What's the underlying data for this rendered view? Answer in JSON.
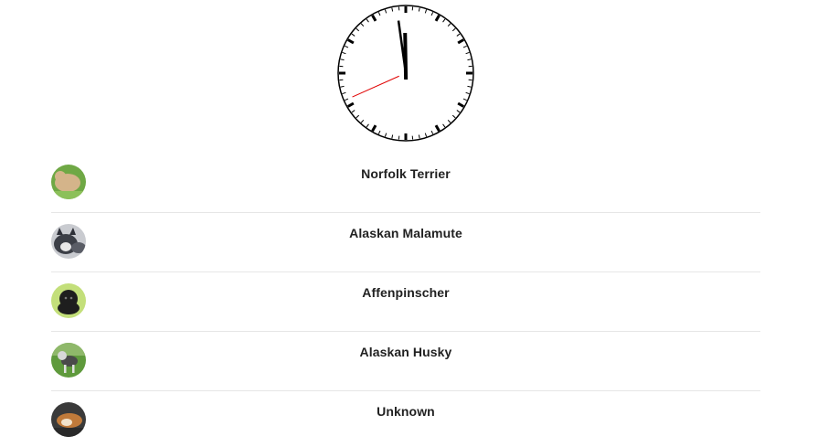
{
  "clock": {
    "hour": 11,
    "minute": 58,
    "second": 41
  },
  "dogs": [
    {
      "name": "Norfolk Terrier",
      "avatar_bg": "#6fa845",
      "avatar_fg": "#d4b48a",
      "avatar_icon": "norfolk-terrier-photo"
    },
    {
      "name": "Alaskan Malamute",
      "avatar_bg": "#c9cbd0",
      "avatar_fg": "#3c3f47",
      "avatar_icon": "alaskan-malamute-photo"
    },
    {
      "name": "Affenpinscher",
      "avatar_bg": "#c3df7a",
      "avatar_fg": "#1e1e1e",
      "avatar_icon": "affenpinscher-photo"
    },
    {
      "name": "Alaskan Husky",
      "avatar_bg": "#5f9a3c",
      "avatar_fg": "#4a4a4a",
      "avatar_icon": "alaskan-husky-photo"
    },
    {
      "name": "Unknown",
      "avatar_bg": "#3a3a3a",
      "avatar_fg": "#c07a3a",
      "avatar_icon": "unknown-dog-photo"
    }
  ]
}
